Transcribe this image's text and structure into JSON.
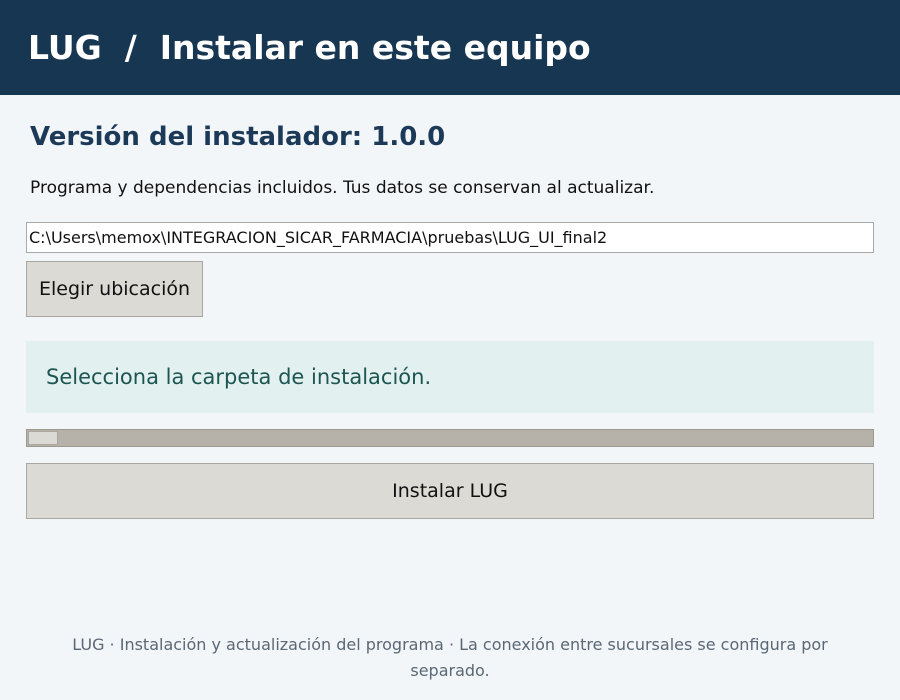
{
  "header": {
    "title": "LUG  /  Instalar en este equipo"
  },
  "main": {
    "version_label": "Versión del instalador: 1.0.0",
    "subtitle": "Programa y dependencias incluidos. Tus datos se conservan al actualizar.",
    "path_value": "C:\\Users\\memox\\INTEGRACION_SICAR_FARMACIA\\pruebas\\LUG_UI_final2",
    "choose_location_label": "Elegir ubicación",
    "status_message": "Selecciona la carpeta de instalación.",
    "progress_percent": 0,
    "install_label": "Instalar LUG"
  },
  "footer": {
    "text": "LUG · Instalación y actualización del programa · La conexión entre sucursales se configura por separado."
  },
  "colors": {
    "header_bg": "#173651",
    "page_bg": "#f3f6f9",
    "status_bg": "#e2f1ef",
    "status_text": "#1d5552",
    "button_bg": "#dcdad5"
  }
}
